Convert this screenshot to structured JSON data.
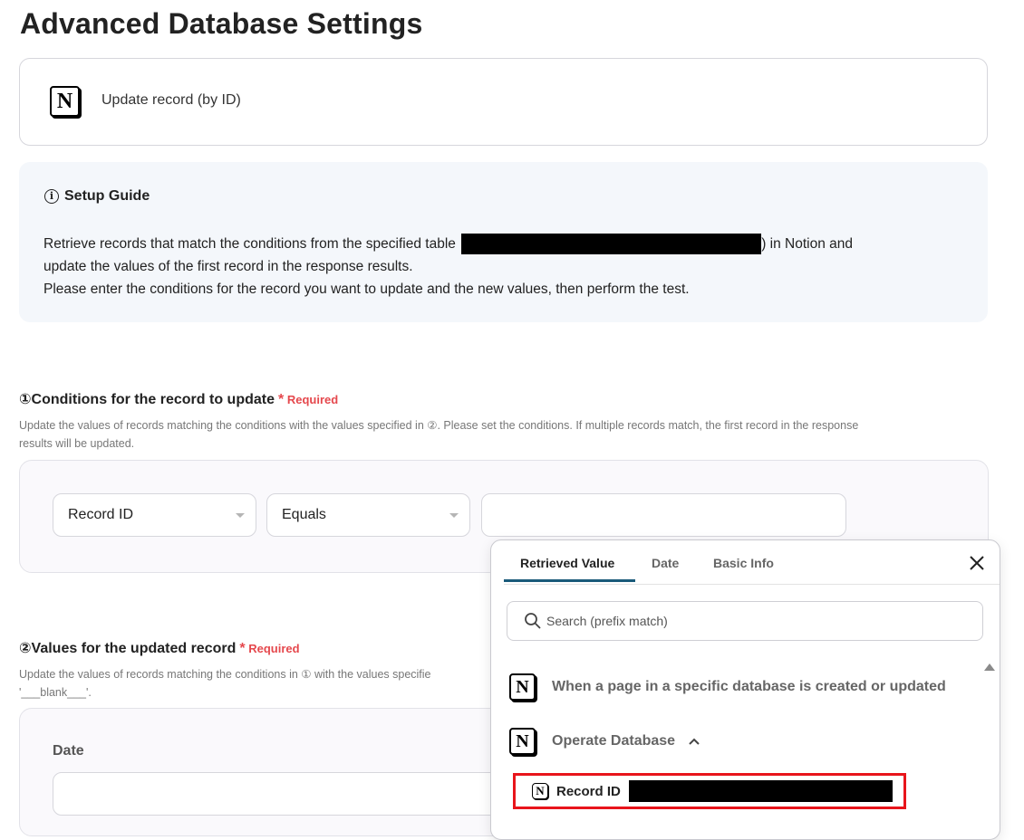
{
  "page": {
    "title": "Advanced Database Settings"
  },
  "operation": {
    "label": "Update record (by ID)",
    "logo_text": "N"
  },
  "guide": {
    "title": "Setup Guide",
    "line1_pre": "Retrieve records that match the conditions from the specified table",
    "line1_post": ") in Notion and",
    "line2": "update the values of the first record in the response results.",
    "line3": "Please enter the conditions for the record you want to update and the new values, then perform the test."
  },
  "section1": {
    "title": "①Conditions for the record to update",
    "required": "Required",
    "hint_line1": "Update the values of records matching the conditions with the values specified in ②. Please set the conditions. If multiple records match, the first record in the response",
    "hint_line2": "results will be updated.",
    "field_select": "Record ID",
    "operator_select": "Equals",
    "value_input": ""
  },
  "section2": {
    "title": "②Values for the updated record",
    "required": "Required",
    "hint_line1": "Update the values of records matching the conditions in ① with the values specifie",
    "hint_line2": "'___blank___'.",
    "date_label": "Date",
    "date_input": ""
  },
  "popup": {
    "tabs": [
      "Retrieved Value",
      "Date",
      "Basic Info"
    ],
    "active_tab": "Retrieved Value",
    "search_placeholder": "Search (prefix match)",
    "items": [
      {
        "label": "When a page in a specific database is created or updated"
      },
      {
        "label": "Operate Database",
        "expanded": true
      }
    ],
    "selected_item": {
      "label": "Record ID"
    }
  },
  "colors": {
    "required": "#e5484d",
    "tab_underline": "#1a5a7a",
    "highlight_border": "#e8151b",
    "guide_bg": "#f4f7fb"
  },
  "icons": [
    "notion-logo-icon",
    "info-icon",
    "search-icon",
    "close-icon",
    "chevron-up-icon",
    "scroll-up-icon",
    "dropdown-caret-icon"
  ]
}
